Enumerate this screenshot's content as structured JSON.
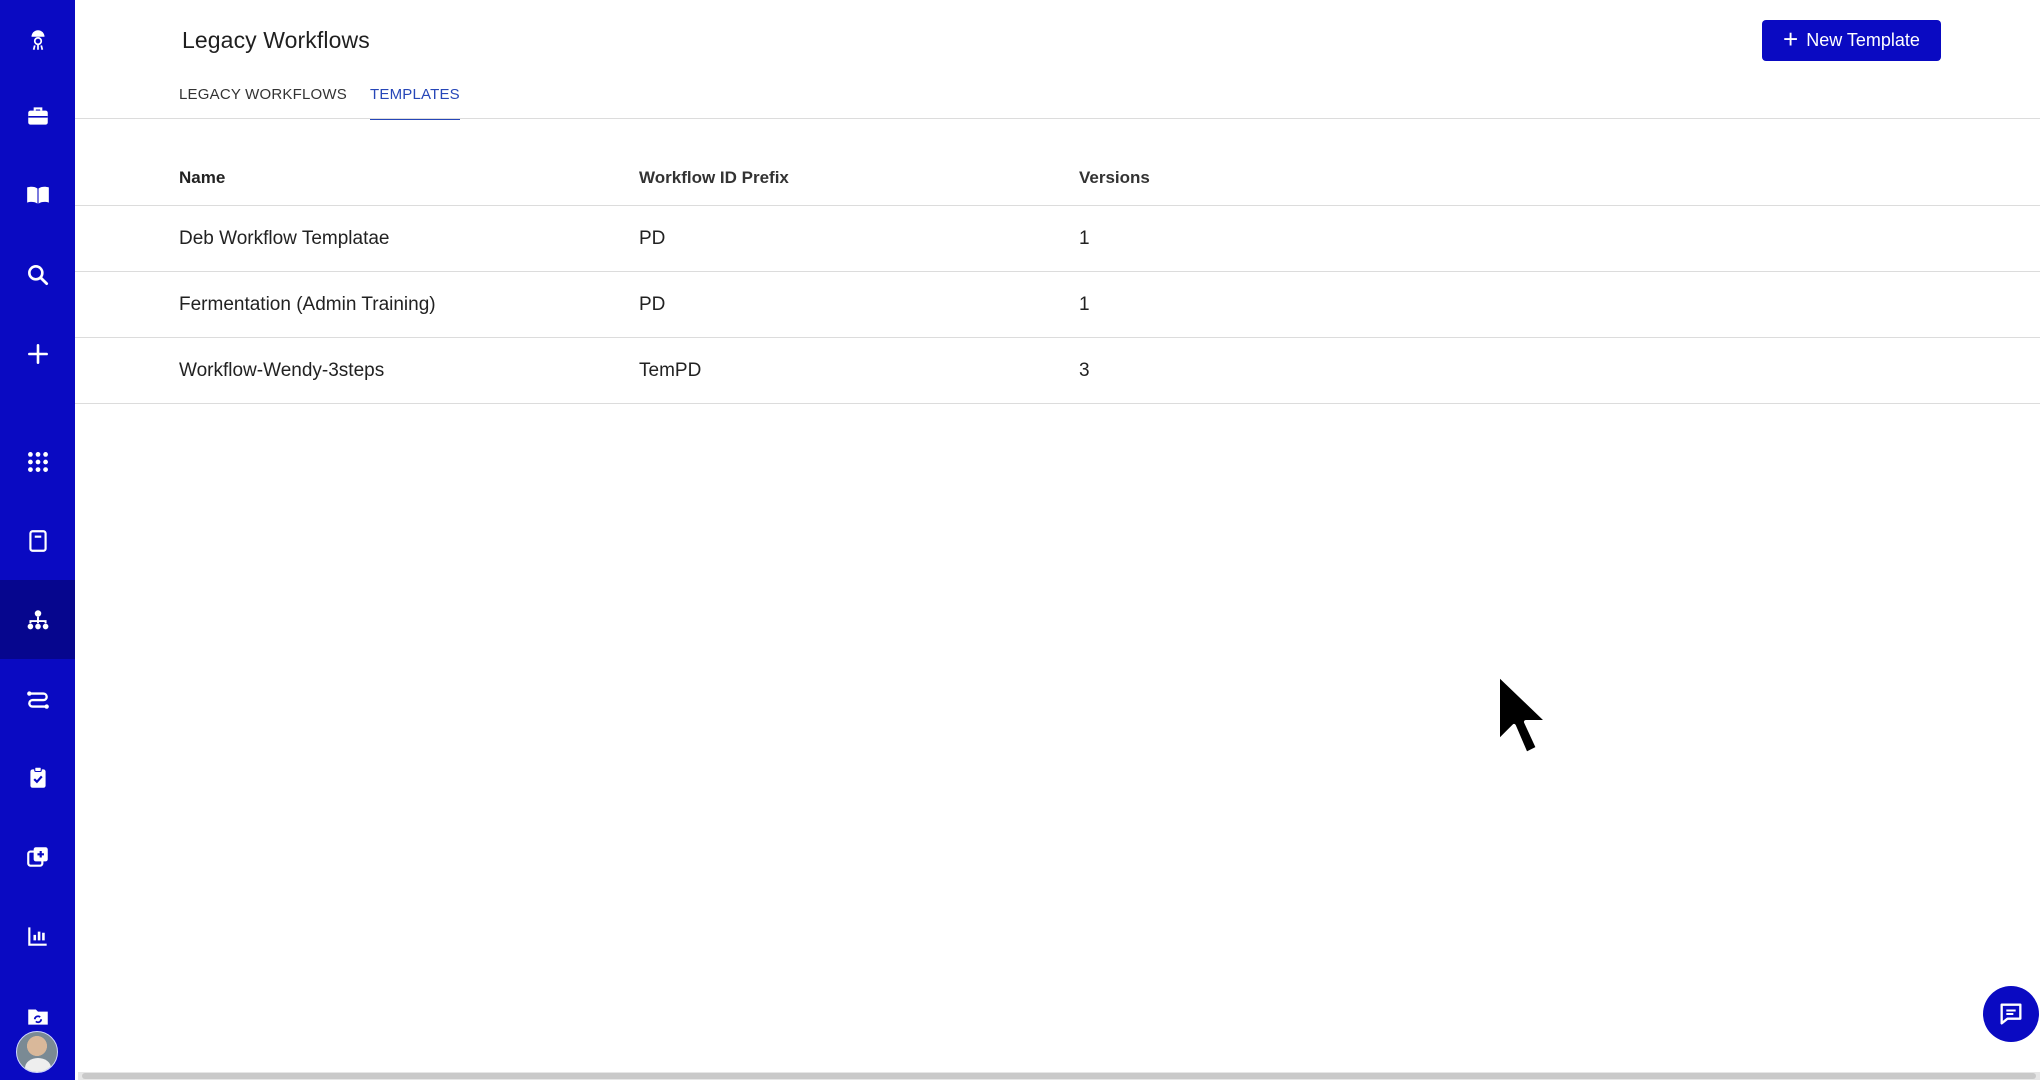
{
  "sidebar": {
    "items": [
      {
        "icon": "mascot-logo-icon"
      },
      {
        "icon": "briefcase-icon"
      },
      {
        "icon": "book-icon"
      },
      {
        "icon": "search-icon"
      },
      {
        "icon": "plus-icon"
      },
      {
        "icon": "apps-grid-icon"
      },
      {
        "icon": "notebook-icon"
      },
      {
        "icon": "workflow-hierarchy-icon",
        "active": true
      },
      {
        "icon": "route-icon"
      },
      {
        "icon": "clipboard-check-icon"
      },
      {
        "icon": "add-copy-icon"
      },
      {
        "icon": "bar-chart-icon"
      },
      {
        "icon": "folder-sync-icon"
      }
    ],
    "avatar": "user-avatar"
  },
  "header": {
    "title": "Legacy Workflows",
    "new_button_label": "New Template"
  },
  "tabs": [
    {
      "label": "LEGACY WORKFLOWS",
      "active": false
    },
    {
      "label": "TEMPLATES",
      "active": true
    }
  ],
  "table": {
    "columns": [
      "Name",
      "Workflow ID Prefix",
      "Versions"
    ],
    "rows": [
      {
        "name": "Deb Workflow Templatae",
        "prefix": "PD",
        "versions": "1"
      },
      {
        "name": "Fermentation (Admin Training)",
        "prefix": "PD",
        "versions": "1"
      },
      {
        "name": "Workflow-Wendy-3steps",
        "prefix": "TemPD",
        "versions": "3"
      }
    ]
  },
  "colors": {
    "sidebar": "#0a0ac2",
    "sidebar_active": "#06068e",
    "accent": "#2646b8",
    "divider": "#dcdcdc"
  }
}
